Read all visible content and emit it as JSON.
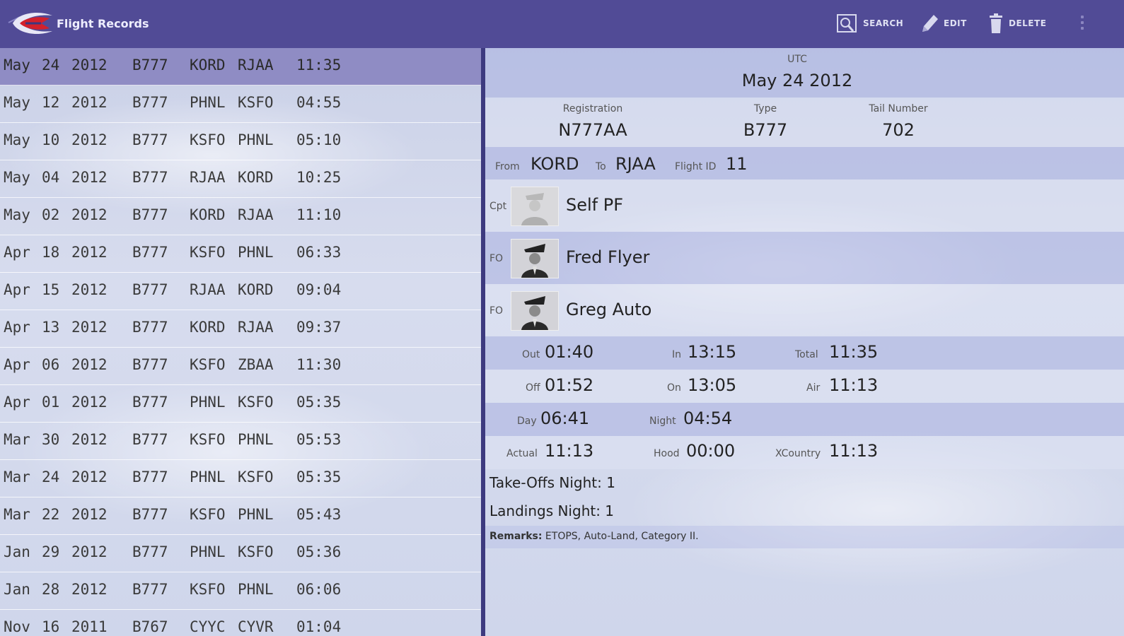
{
  "actionbar": {
    "title": "Flight Records",
    "actions": {
      "search": "SEARCH",
      "edit": "EDIT",
      "delete": "DELETE"
    },
    "color": "#514b96"
  },
  "flights": [
    {
      "month": "May",
      "day": "24",
      "year": "2012",
      "type": "B777",
      "from": "KORD",
      "to": "RJAA",
      "duration": "11:35",
      "selected": true
    },
    {
      "month": "May",
      "day": "12",
      "year": "2012",
      "type": "B777",
      "from": "PHNL",
      "to": "KSFO",
      "duration": "04:55"
    },
    {
      "month": "May",
      "day": "10",
      "year": "2012",
      "type": "B777",
      "from": "KSFO",
      "to": "PHNL",
      "duration": "05:10"
    },
    {
      "month": "May",
      "day": "04",
      "year": "2012",
      "type": "B777",
      "from": "RJAA",
      "to": "KORD",
      "duration": "10:25"
    },
    {
      "month": "May",
      "day": "02",
      "year": "2012",
      "type": "B777",
      "from": "KORD",
      "to": "RJAA",
      "duration": "11:10"
    },
    {
      "month": "Apr",
      "day": "18",
      "year": "2012",
      "type": "B777",
      "from": "KSFO",
      "to": "PHNL",
      "duration": "06:33"
    },
    {
      "month": "Apr",
      "day": "15",
      "year": "2012",
      "type": "B777",
      "from": "RJAA",
      "to": "KORD",
      "duration": "09:04"
    },
    {
      "month": "Apr",
      "day": "13",
      "year": "2012",
      "type": "B777",
      "from": "KORD",
      "to": "RJAA",
      "duration": "09:37"
    },
    {
      "month": "Apr",
      "day": "06",
      "year": "2012",
      "type": "B777",
      "from": "KSFO",
      "to": "ZBAA",
      "duration": "11:30"
    },
    {
      "month": "Apr",
      "day": "01",
      "year": "2012",
      "type": "B777",
      "from": "PHNL",
      "to": "KSFO",
      "duration": "05:35"
    },
    {
      "month": "Mar",
      "day": "30",
      "year": "2012",
      "type": "B777",
      "from": "KSFO",
      "to": "PHNL",
      "duration": "05:53"
    },
    {
      "month": "Mar",
      "day": "24",
      "year": "2012",
      "type": "B777",
      "from": "PHNL",
      "to": "KSFO",
      "duration": "05:35"
    },
    {
      "month": "Mar",
      "day": "22",
      "year": "2012",
      "type": "B777",
      "from": "KSFO",
      "to": "PHNL",
      "duration": "05:43"
    },
    {
      "month": "Jan",
      "day": "29",
      "year": "2012",
      "type": "B777",
      "from": "PHNL",
      "to": "KSFO",
      "duration": "05:36"
    },
    {
      "month": "Jan",
      "day": "28",
      "year": "2012",
      "type": "B777",
      "from": "KSFO",
      "to": "PHNL",
      "duration": "06:06"
    },
    {
      "month": "Nov",
      "day": "16",
      "year": "2011",
      "type": "B767",
      "from": "CYYC",
      "to": "CYVR",
      "duration": "01:04"
    }
  ],
  "detail": {
    "utc_label": "UTC",
    "date": "May 24 2012",
    "registration_label": "Registration",
    "registration": "N777AA",
    "type_label": "Type",
    "type": "B777",
    "tail_label": "Tail Number",
    "tail": "702",
    "from_label": "From",
    "from": "KORD",
    "to_label": "To",
    "to": "RJAA",
    "flight_id_label": "Flight ID",
    "flight_id": "11",
    "crew": [
      {
        "role": "Cpt",
        "name": "Self PF"
      },
      {
        "role": "FO",
        "name": "Fred Flyer"
      },
      {
        "role": "FO",
        "name": "Greg Auto"
      }
    ],
    "times": {
      "out_label": "Out",
      "out": "01:40",
      "in_label": "In",
      "in": "13:15",
      "total_label": "Total",
      "total": "11:35",
      "off_label": "Off",
      "off": "01:52",
      "on_label": "On",
      "on": "13:05",
      "air_label": "Air",
      "air": "11:13",
      "day_label": "Day",
      "day": "06:41",
      "night_label": "Night",
      "night": "04:54",
      "actual_label": "Actual",
      "actual": "11:13",
      "hood_label": "Hood",
      "hood": "00:00",
      "xcountry_label": "XCountry",
      "xcountry": "11:13"
    },
    "takeoffs": "Take-Offs Night: 1",
    "landings": "Landings Night: 1",
    "remarks_label": "Remarks:",
    "remarks": "ETOPS, Auto-Land, Category II."
  }
}
